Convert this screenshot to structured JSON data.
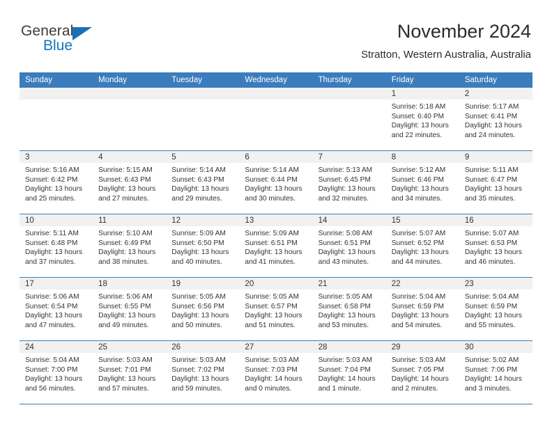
{
  "brand": {
    "name_part1": "General",
    "name_part2": "Blue",
    "logo_icon": "blue-triangle-logo",
    "color_blue": "#1276bd"
  },
  "header": {
    "title": "November 2024",
    "subtitle": "Stratton, Western Australia, Australia"
  },
  "theme": {
    "header_bg": "#3b7cbd",
    "daynum_bg": "#f1f1f1",
    "grid_line": "#3b7cbd"
  },
  "weekday_headers": [
    "Sunday",
    "Monday",
    "Tuesday",
    "Wednesday",
    "Thursday",
    "Friday",
    "Saturday"
  ],
  "weeks": [
    [
      {
        "day": "",
        "empty": true,
        "sunrise": "",
        "sunset": "",
        "daylight1": "",
        "daylight2": ""
      },
      {
        "day": "",
        "empty": true,
        "sunrise": "",
        "sunset": "",
        "daylight1": "",
        "daylight2": ""
      },
      {
        "day": "",
        "empty": true,
        "sunrise": "",
        "sunset": "",
        "daylight1": "",
        "daylight2": ""
      },
      {
        "day": "",
        "empty": true,
        "sunrise": "",
        "sunset": "",
        "daylight1": "",
        "daylight2": ""
      },
      {
        "day": "",
        "empty": true,
        "sunrise": "",
        "sunset": "",
        "daylight1": "",
        "daylight2": ""
      },
      {
        "day": "1",
        "empty": false,
        "sunrise": "Sunrise: 5:18 AM",
        "sunset": "Sunset: 6:40 PM",
        "daylight1": "Daylight: 13 hours",
        "daylight2": "and 22 minutes."
      },
      {
        "day": "2",
        "empty": false,
        "sunrise": "Sunrise: 5:17 AM",
        "sunset": "Sunset: 6:41 PM",
        "daylight1": "Daylight: 13 hours",
        "daylight2": "and 24 minutes."
      }
    ],
    [
      {
        "day": "3",
        "empty": false,
        "sunrise": "Sunrise: 5:16 AM",
        "sunset": "Sunset: 6:42 PM",
        "daylight1": "Daylight: 13 hours",
        "daylight2": "and 25 minutes."
      },
      {
        "day": "4",
        "empty": false,
        "sunrise": "Sunrise: 5:15 AM",
        "sunset": "Sunset: 6:43 PM",
        "daylight1": "Daylight: 13 hours",
        "daylight2": "and 27 minutes."
      },
      {
        "day": "5",
        "empty": false,
        "sunrise": "Sunrise: 5:14 AM",
        "sunset": "Sunset: 6:43 PM",
        "daylight1": "Daylight: 13 hours",
        "daylight2": "and 29 minutes."
      },
      {
        "day": "6",
        "empty": false,
        "sunrise": "Sunrise: 5:14 AM",
        "sunset": "Sunset: 6:44 PM",
        "daylight1": "Daylight: 13 hours",
        "daylight2": "and 30 minutes."
      },
      {
        "day": "7",
        "empty": false,
        "sunrise": "Sunrise: 5:13 AM",
        "sunset": "Sunset: 6:45 PM",
        "daylight1": "Daylight: 13 hours",
        "daylight2": "and 32 minutes."
      },
      {
        "day": "8",
        "empty": false,
        "sunrise": "Sunrise: 5:12 AM",
        "sunset": "Sunset: 6:46 PM",
        "daylight1": "Daylight: 13 hours",
        "daylight2": "and 34 minutes."
      },
      {
        "day": "9",
        "empty": false,
        "sunrise": "Sunrise: 5:11 AM",
        "sunset": "Sunset: 6:47 PM",
        "daylight1": "Daylight: 13 hours",
        "daylight2": "and 35 minutes."
      }
    ],
    [
      {
        "day": "10",
        "empty": false,
        "sunrise": "Sunrise: 5:11 AM",
        "sunset": "Sunset: 6:48 PM",
        "daylight1": "Daylight: 13 hours",
        "daylight2": "and 37 minutes."
      },
      {
        "day": "11",
        "empty": false,
        "sunrise": "Sunrise: 5:10 AM",
        "sunset": "Sunset: 6:49 PM",
        "daylight1": "Daylight: 13 hours",
        "daylight2": "and 38 minutes."
      },
      {
        "day": "12",
        "empty": false,
        "sunrise": "Sunrise: 5:09 AM",
        "sunset": "Sunset: 6:50 PM",
        "daylight1": "Daylight: 13 hours",
        "daylight2": "and 40 minutes."
      },
      {
        "day": "13",
        "empty": false,
        "sunrise": "Sunrise: 5:09 AM",
        "sunset": "Sunset: 6:51 PM",
        "daylight1": "Daylight: 13 hours",
        "daylight2": "and 41 minutes."
      },
      {
        "day": "14",
        "empty": false,
        "sunrise": "Sunrise: 5:08 AM",
        "sunset": "Sunset: 6:51 PM",
        "daylight1": "Daylight: 13 hours",
        "daylight2": "and 43 minutes."
      },
      {
        "day": "15",
        "empty": false,
        "sunrise": "Sunrise: 5:07 AM",
        "sunset": "Sunset: 6:52 PM",
        "daylight1": "Daylight: 13 hours",
        "daylight2": "and 44 minutes."
      },
      {
        "day": "16",
        "empty": false,
        "sunrise": "Sunrise: 5:07 AM",
        "sunset": "Sunset: 6:53 PM",
        "daylight1": "Daylight: 13 hours",
        "daylight2": "and 46 minutes."
      }
    ],
    [
      {
        "day": "17",
        "empty": false,
        "sunrise": "Sunrise: 5:06 AM",
        "sunset": "Sunset: 6:54 PM",
        "daylight1": "Daylight: 13 hours",
        "daylight2": "and 47 minutes."
      },
      {
        "day": "18",
        "empty": false,
        "sunrise": "Sunrise: 5:06 AM",
        "sunset": "Sunset: 6:55 PM",
        "daylight1": "Daylight: 13 hours",
        "daylight2": "and 49 minutes."
      },
      {
        "day": "19",
        "empty": false,
        "sunrise": "Sunrise: 5:05 AM",
        "sunset": "Sunset: 6:56 PM",
        "daylight1": "Daylight: 13 hours",
        "daylight2": "and 50 minutes."
      },
      {
        "day": "20",
        "empty": false,
        "sunrise": "Sunrise: 5:05 AM",
        "sunset": "Sunset: 6:57 PM",
        "daylight1": "Daylight: 13 hours",
        "daylight2": "and 51 minutes."
      },
      {
        "day": "21",
        "empty": false,
        "sunrise": "Sunrise: 5:05 AM",
        "sunset": "Sunset: 6:58 PM",
        "daylight1": "Daylight: 13 hours",
        "daylight2": "and 53 minutes."
      },
      {
        "day": "22",
        "empty": false,
        "sunrise": "Sunrise: 5:04 AM",
        "sunset": "Sunset: 6:59 PM",
        "daylight1": "Daylight: 13 hours",
        "daylight2": "and 54 minutes."
      },
      {
        "day": "23",
        "empty": false,
        "sunrise": "Sunrise: 5:04 AM",
        "sunset": "Sunset: 6:59 PM",
        "daylight1": "Daylight: 13 hours",
        "daylight2": "and 55 minutes."
      }
    ],
    [
      {
        "day": "24",
        "empty": false,
        "sunrise": "Sunrise: 5:04 AM",
        "sunset": "Sunset: 7:00 PM",
        "daylight1": "Daylight: 13 hours",
        "daylight2": "and 56 minutes."
      },
      {
        "day": "25",
        "empty": false,
        "sunrise": "Sunrise: 5:03 AM",
        "sunset": "Sunset: 7:01 PM",
        "daylight1": "Daylight: 13 hours",
        "daylight2": "and 57 minutes."
      },
      {
        "day": "26",
        "empty": false,
        "sunrise": "Sunrise: 5:03 AM",
        "sunset": "Sunset: 7:02 PM",
        "daylight1": "Daylight: 13 hours",
        "daylight2": "and 59 minutes."
      },
      {
        "day": "27",
        "empty": false,
        "sunrise": "Sunrise: 5:03 AM",
        "sunset": "Sunset: 7:03 PM",
        "daylight1": "Daylight: 14 hours",
        "daylight2": "and 0 minutes."
      },
      {
        "day": "28",
        "empty": false,
        "sunrise": "Sunrise: 5:03 AM",
        "sunset": "Sunset: 7:04 PM",
        "daylight1": "Daylight: 14 hours",
        "daylight2": "and 1 minute."
      },
      {
        "day": "29",
        "empty": false,
        "sunrise": "Sunrise: 5:03 AM",
        "sunset": "Sunset: 7:05 PM",
        "daylight1": "Daylight: 14 hours",
        "daylight2": "and 2 minutes."
      },
      {
        "day": "30",
        "empty": false,
        "sunrise": "Sunrise: 5:02 AM",
        "sunset": "Sunset: 7:06 PM",
        "daylight1": "Daylight: 14 hours",
        "daylight2": "and 3 minutes."
      }
    ]
  ]
}
